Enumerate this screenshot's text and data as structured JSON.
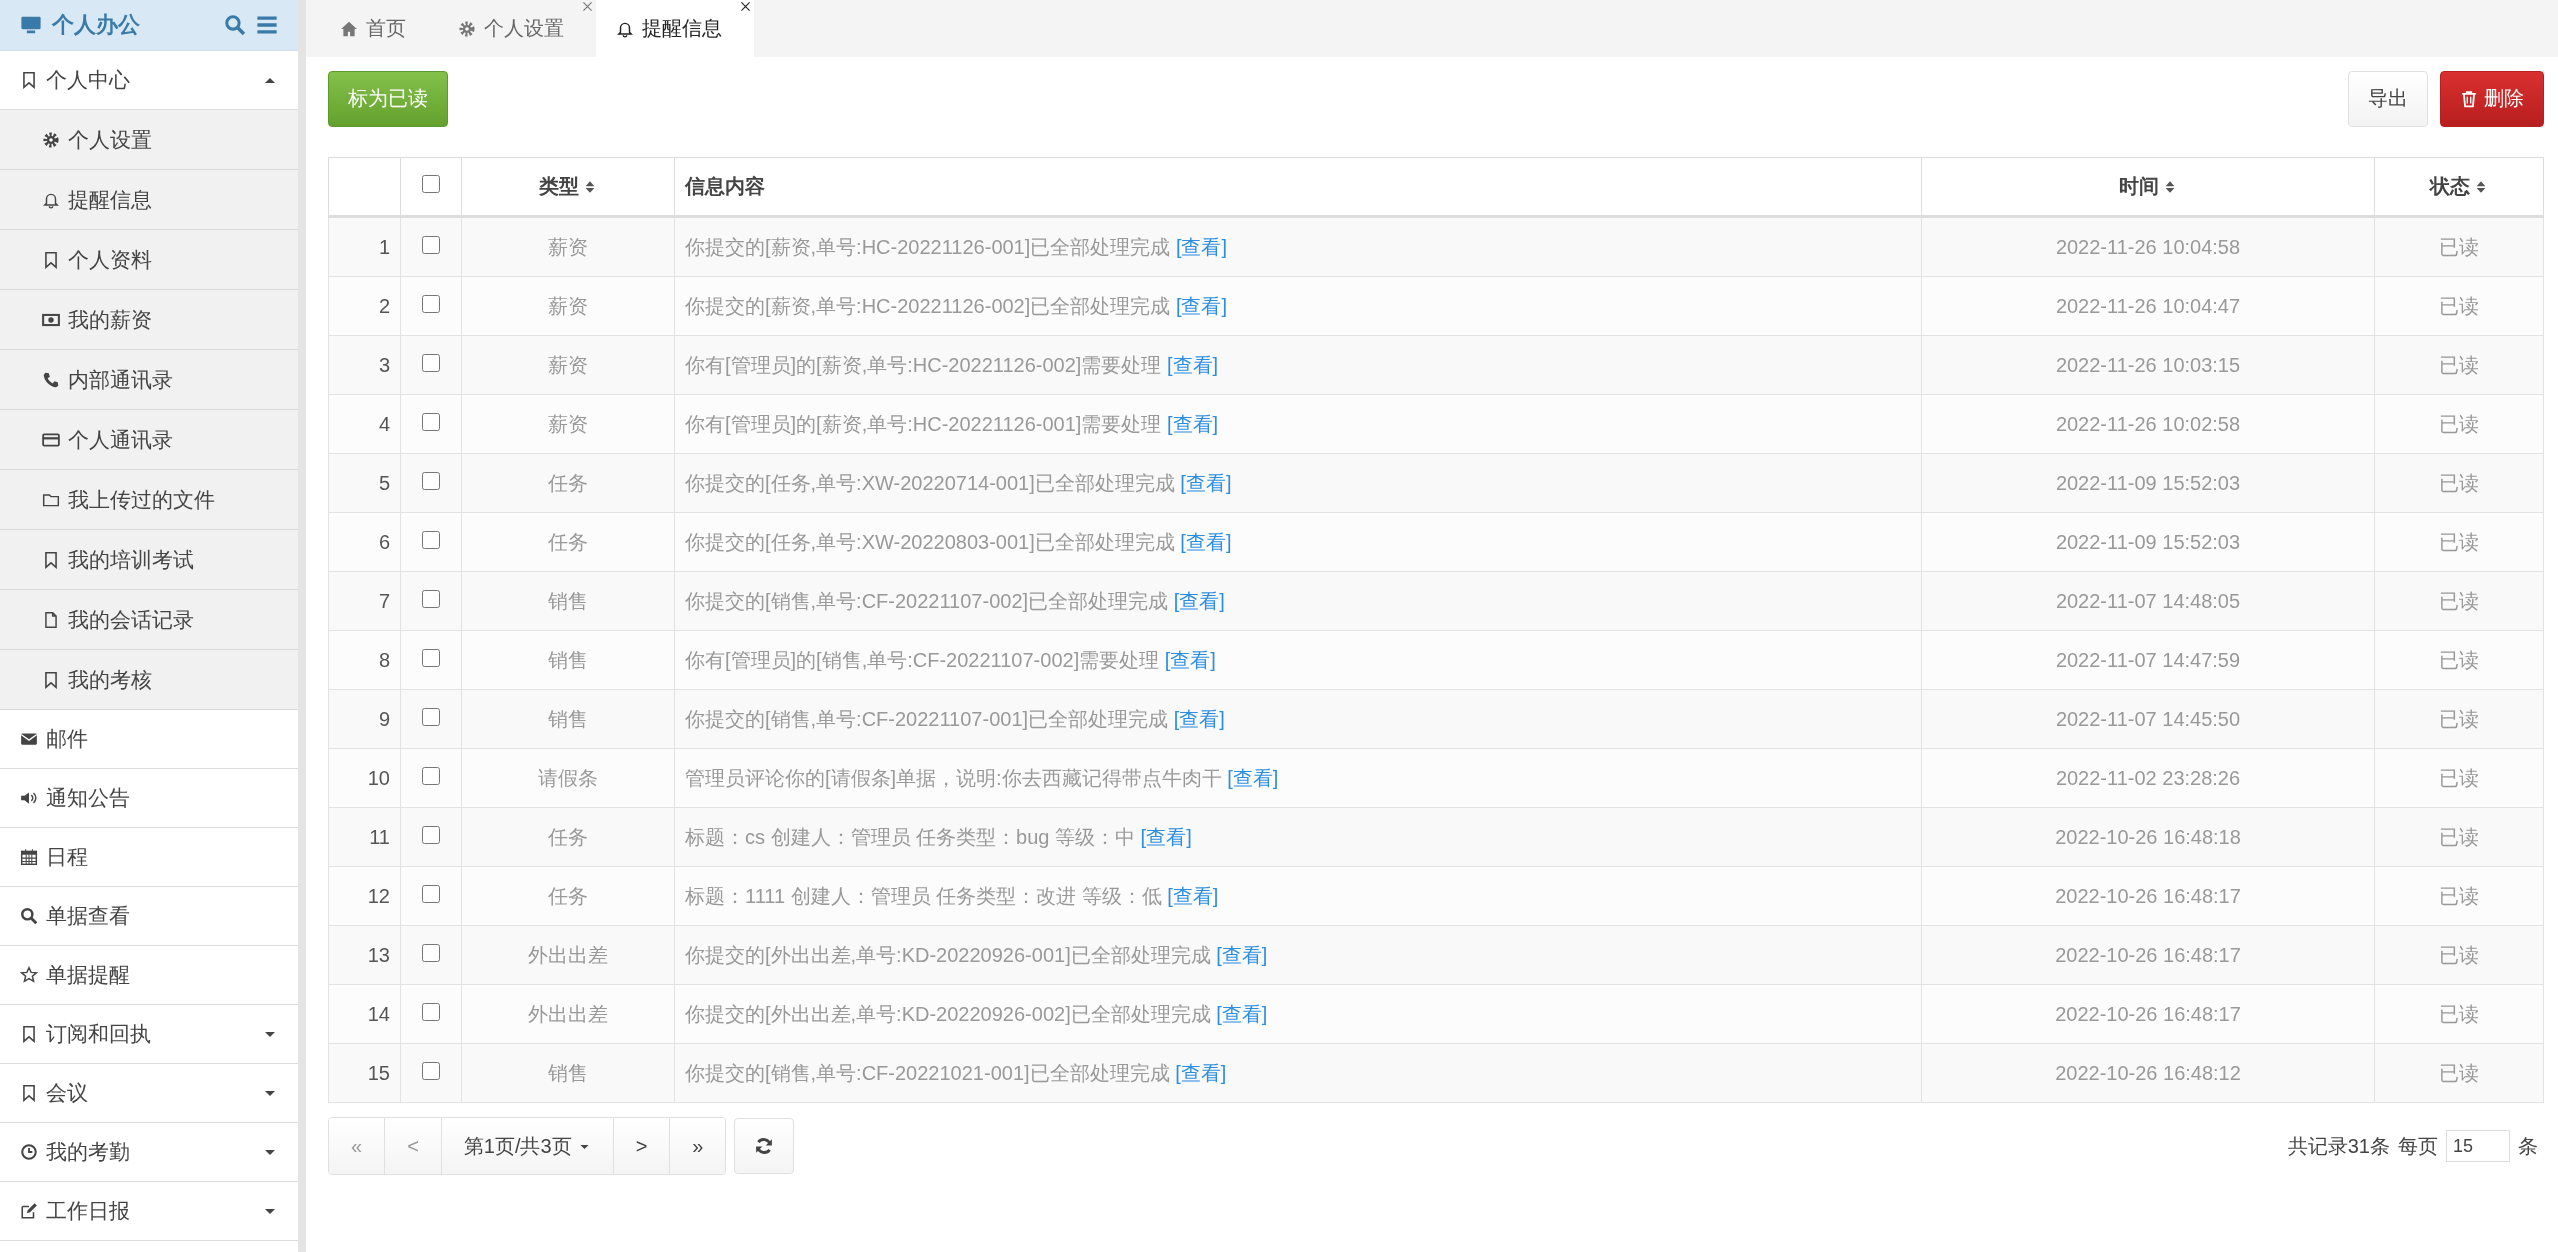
{
  "sidebar": {
    "title": "个人办公",
    "items": [
      {
        "label": "个人中心",
        "expanded": true,
        "children": [
          {
            "label": "个人设置",
            "selected": false
          },
          {
            "label": "提醒信息",
            "selected": false
          },
          {
            "label": "个人资料",
            "selected": false
          },
          {
            "label": "我的薪资",
            "selected": false
          },
          {
            "label": "内部通讯录",
            "selected": false
          },
          {
            "label": "个人通讯录",
            "selected": false
          },
          {
            "label": "我上传过的文件",
            "selected": false
          },
          {
            "label": "我的培训考试",
            "selected": false
          },
          {
            "label": "我的会话记录",
            "selected": false
          },
          {
            "label": "我的考核",
            "selected": false
          }
        ]
      },
      {
        "label": "邮件"
      },
      {
        "label": "通知公告"
      },
      {
        "label": "日程"
      },
      {
        "label": "单据查看"
      },
      {
        "label": "单据提醒"
      },
      {
        "label": "订阅和回执",
        "expanded": false
      },
      {
        "label": "会议",
        "expanded": false
      },
      {
        "label": "我的考勤",
        "expanded": false
      },
      {
        "label": "工作日报",
        "expanded": false
      }
    ]
  },
  "tabs": [
    {
      "label": "首页",
      "selected": false,
      "closable": false
    },
    {
      "label": "个人设置",
      "selected": false,
      "closable": true
    },
    {
      "label": "提醒信息",
      "selected": true,
      "closable": true
    }
  ],
  "toolbar": {
    "mark_read": "标为已读",
    "export": "导出",
    "delete": "删除"
  },
  "table": {
    "columns": [
      {
        "kind": "index"
      },
      {
        "kind": "checkbox",
        "checked": false
      },
      {
        "label": "类型",
        "kind": "text",
        "sortable": true
      },
      {
        "label": "信息内容",
        "kind": "text",
        "sortable": false
      },
      {
        "label": "时间",
        "kind": "text",
        "sortable": true
      },
      {
        "label": "状态",
        "kind": "text",
        "sortable": true
      }
    ],
    "rows": [
      {
        "index": "1",
        "checked": false,
        "type": "薪资",
        "content": "你提交的[薪资,单号:HC-20221126-001]已全部处理完成",
        "link": "[查看]",
        "time": "2022-11-26 10:04:58",
        "status": "已读"
      },
      {
        "index": "2",
        "checked": false,
        "type": "薪资",
        "content": "你提交的[薪资,单号:HC-20221126-002]已全部处理完成",
        "link": "[查看]",
        "time": "2022-11-26 10:04:47",
        "status": "已读"
      },
      {
        "index": "3",
        "checked": false,
        "type": "薪资",
        "content": "你有[管理员]的[薪资,单号:HC-20221126-002]需要处理",
        "link": "[查看]",
        "time": "2022-11-26 10:03:15",
        "status": "已读"
      },
      {
        "index": "4",
        "checked": false,
        "type": "薪资",
        "content": "你有[管理员]的[薪资,单号:HC-20221126-001]需要处理",
        "link": "[查看]",
        "time": "2022-11-26 10:02:58",
        "status": "已读"
      },
      {
        "index": "5",
        "checked": false,
        "type": "任务",
        "content": "你提交的[任务,单号:XW-20220714-001]已全部处理完成",
        "link": "[查看]",
        "time": "2022-11-09 15:52:03",
        "status": "已读"
      },
      {
        "index": "6",
        "checked": false,
        "type": "任务",
        "content": "你提交的[任务,单号:XW-20220803-001]已全部处理完成",
        "link": "[查看]",
        "time": "2022-11-09 15:52:03",
        "status": "已读"
      },
      {
        "index": "7",
        "checked": false,
        "type": "销售",
        "content": "你提交的[销售,单号:CF-20221107-002]已全部处理完成",
        "link": "[查看]",
        "time": "2022-11-07 14:48:05",
        "status": "已读"
      },
      {
        "index": "8",
        "checked": false,
        "type": "销售",
        "content": "你有[管理员]的[销售,单号:CF-20221107-002]需要处理",
        "link": "[查看]",
        "time": "2022-11-07 14:47:59",
        "status": "已读"
      },
      {
        "index": "9",
        "checked": false,
        "type": "销售",
        "content": "你提交的[销售,单号:CF-20221107-001]已全部处理完成",
        "link": "[查看]",
        "time": "2022-11-07 14:45:50",
        "status": "已读"
      },
      {
        "index": "10",
        "checked": false,
        "type": "请假条",
        "content": "管理员评论你的[请假条]单据，说明:你去西藏记得带点牛肉干",
        "link": "[查看]",
        "time": "2022-11-02 23:28:26",
        "status": "已读"
      },
      {
        "index": "11",
        "checked": false,
        "type": "任务",
        "content": "标题：cs 创建人：管理员 任务类型：bug 等级：中",
        "link": "[查看]",
        "time": "2022-10-26 16:48:18",
        "status": "已读"
      },
      {
        "index": "12",
        "checked": false,
        "type": "任务",
        "content": "标题：1111 创建人：管理员 任务类型：改进 等级：低",
        "link": "[查看]",
        "time": "2022-10-26 16:48:17",
        "status": "已读"
      },
      {
        "index": "13",
        "checked": false,
        "type": "外出出差",
        "content": "你提交的[外出出差,单号:KD-20220926-001]已全部处理完成",
        "link": "[查看]",
        "time": "2022-10-26 16:48:17",
        "status": "已读"
      },
      {
        "index": "14",
        "checked": false,
        "type": "外出出差",
        "content": "你提交的[外出出差,单号:KD-20220926-002]已全部处理完成",
        "link": "[查看]",
        "time": "2022-10-26 16:48:17",
        "status": "已读"
      },
      {
        "index": "15",
        "checked": false,
        "type": "销售",
        "content": "你提交的[销售,单号:CF-20221021-001]已全部处理完成",
        "link": "[查看]",
        "time": "2022-10-26 16:48:12",
        "status": "已读"
      }
    ]
  },
  "pagination": {
    "first": "«",
    "prev": "<",
    "page": "第1页/共3页",
    "next": ">",
    "last": "»",
    "total": "共记录31条",
    "per_page_label": "每页",
    "per_page": "15",
    "per_page_unit": "条"
  }
}
